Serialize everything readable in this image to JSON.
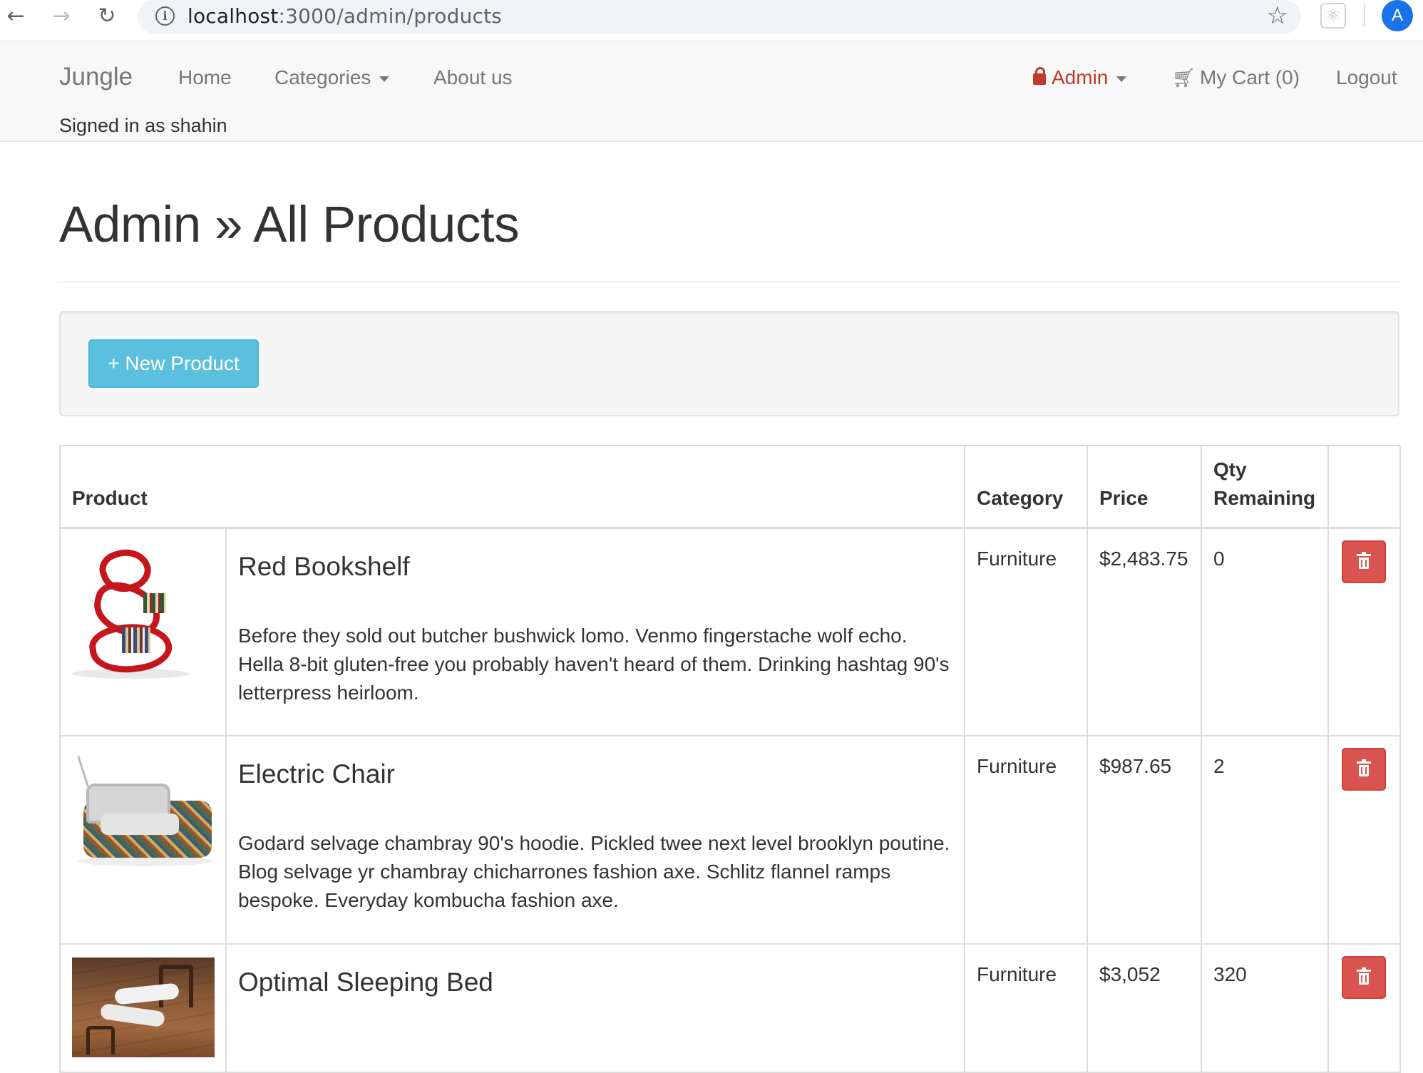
{
  "browser": {
    "url_host": "localhost",
    "url_rest": ":3000/admin/products",
    "profile_initial": "A",
    "icons": [
      "back-arrow-icon",
      "forward-arrow-icon",
      "reload-icon",
      "info-icon",
      "star-icon",
      "react-devtools-icon"
    ]
  },
  "navbar": {
    "brand": "Jungle",
    "home": "Home",
    "categories": "Categories",
    "about": "About us",
    "admin": "Admin",
    "cart": "My Cart (0)",
    "logout": "Logout",
    "signed_in": "Signed in as shahin",
    "admin_color": "#c0392b"
  },
  "page": {
    "title": "Admin » All Products",
    "new_product_label": "+ New Product",
    "accent": "#5bc0de",
    "danger": "#d9534f"
  },
  "table": {
    "headers": {
      "product": "Product",
      "category": "Category",
      "price": "Price",
      "qty": "Qty Remaining"
    },
    "rows": [
      {
        "name": "Red Bookshelf",
        "description": "Before they sold out butcher bushwick lomo. Venmo fingerstache wolf echo. Hella 8-bit gluten-free you probably haven't heard of them. Drinking hashtag 90's letterpress heirloom.",
        "category": "Furniture",
        "price": "$2,483.75",
        "qty": "0"
      },
      {
        "name": "Electric Chair",
        "description": "Godard selvage chambray 90's hoodie. Pickled twee next level brooklyn poutine. Blog selvage yr chambray chicharrones fashion axe. Schlitz flannel ramps bespoke. Everyday kombucha fashion axe.",
        "category": "Furniture",
        "price": "$987.65",
        "qty": "2"
      },
      {
        "name": "Optimal Sleeping Bed",
        "description": "",
        "category": "Furniture",
        "price": "$3,052",
        "qty": "320"
      }
    ]
  }
}
